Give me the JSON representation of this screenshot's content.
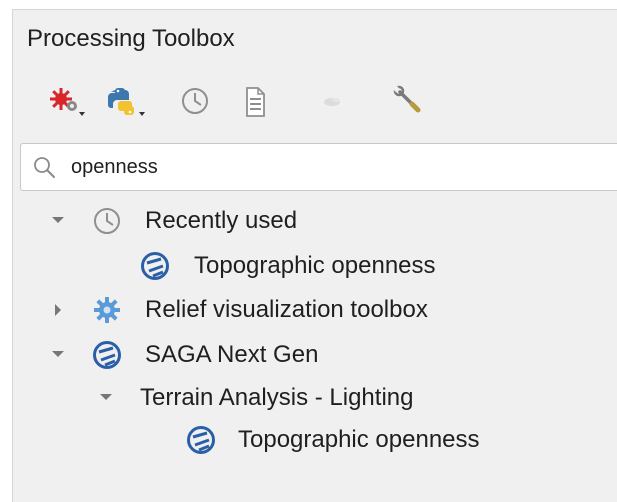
{
  "panel": {
    "title": "Processing Toolbox"
  },
  "toolbar": [
    {
      "name": "models-icon"
    },
    {
      "name": "python-icon"
    },
    {
      "name": "history-icon"
    },
    {
      "name": "results-viewer-icon"
    },
    {
      "name": "edit-features-icon"
    },
    {
      "name": "options-wrench-icon"
    }
  ],
  "search": {
    "value": "openness",
    "placeholder": ""
  },
  "tree": {
    "recently_used": {
      "label": "Recently used",
      "icon": "history-icon",
      "expanded": true
    },
    "recent_topo": {
      "label": "Topographic openness",
      "icon": "saga-icon"
    },
    "relief": {
      "label": "Relief visualization toolbox",
      "icon": "plugin-gear-icon",
      "expanded": false
    },
    "saga": {
      "label": "SAGA Next Gen",
      "icon": "saga-icon",
      "expanded": true
    },
    "terrain": {
      "label": "Terrain Analysis - Lighting",
      "expanded": true
    },
    "saga_topo": {
      "label": "Topographic openness",
      "icon": "saga-icon"
    }
  },
  "colors": {
    "saga_blue": "#2a5fa8",
    "gear_blue": "#5a9ad6",
    "python_blue": "#3e77ad",
    "python_yellow": "#f2c230",
    "models_red": "#d8262a",
    "arrow_gray": "#777777",
    "panel_bg": "#f0f0f0"
  }
}
